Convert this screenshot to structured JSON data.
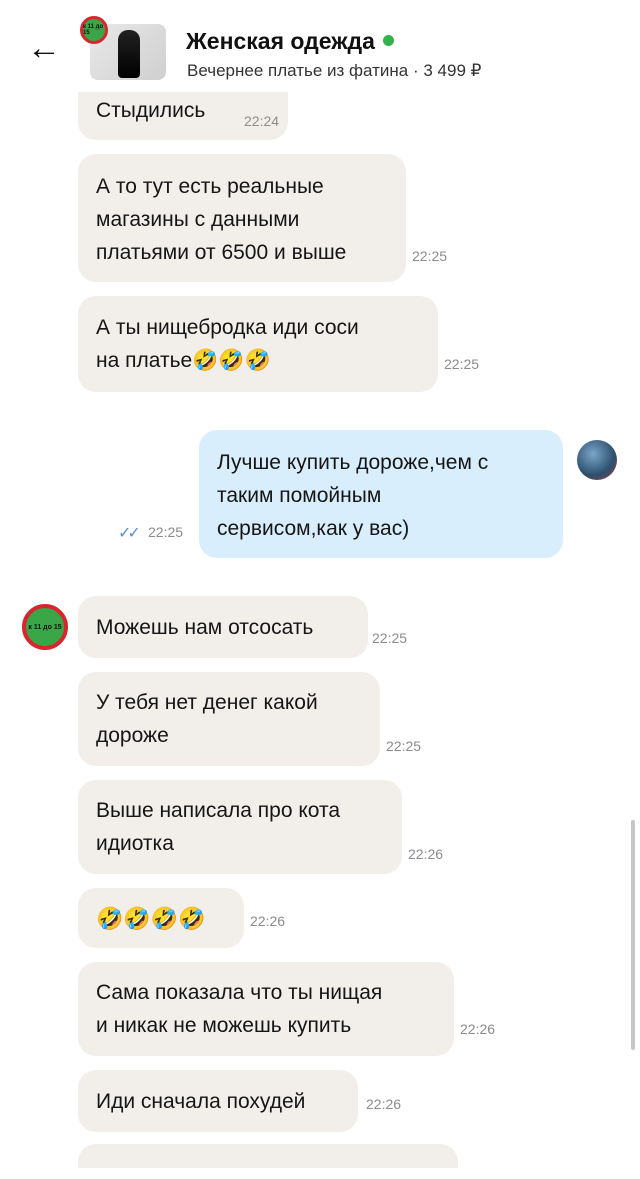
{
  "header": {
    "back_icon": "arrow-left-icon",
    "shop_badge": "к 11 до 15",
    "title": "Женская одежда",
    "online_color": "#32b34a",
    "subtitle": "Вечернее платье из фатина · 3 499 ₽"
  },
  "messages": [
    {
      "text": "Стыдились",
      "time": "22:24"
    },
    {
      "text": "А то тут есть реальные магазины с данными платьями от 6500 и выше",
      "lines": [
        "А то тут есть реальные",
        "магазины с данными",
        "платьями от 6500 и выше"
      ],
      "time": "22:25"
    },
    {
      "lines": [
        "А ты нищебродка  иди соси",
        "на платье🤣🤣🤣"
      ],
      "time": "22:25"
    },
    {
      "lines": [
        "Лучше купить дороже,чем с",
        "таким помойным",
        "сервисом,как у вас)"
      ],
      "time": "22:25",
      "read": "✓✓"
    },
    {
      "text": "Можешь нам отсосать",
      "time": "22:25"
    },
    {
      "lines": [
        "У тебя нет денег какой",
        "дороже"
      ],
      "time": "22:25"
    },
    {
      "lines": [
        "Выше написала про кота",
        "идиотка"
      ],
      "time": "22:26"
    },
    {
      "text": "🤣🤣🤣🤣",
      "time": "22:26"
    },
    {
      "lines": [
        "Сама показала что  ты нищая",
        "и никак не можешь купить"
      ],
      "time": "22:26"
    },
    {
      "text": "Иди сначала похудей",
      "time": "22:26"
    }
  ],
  "shop_avatar_badge": "к 11 до 15"
}
